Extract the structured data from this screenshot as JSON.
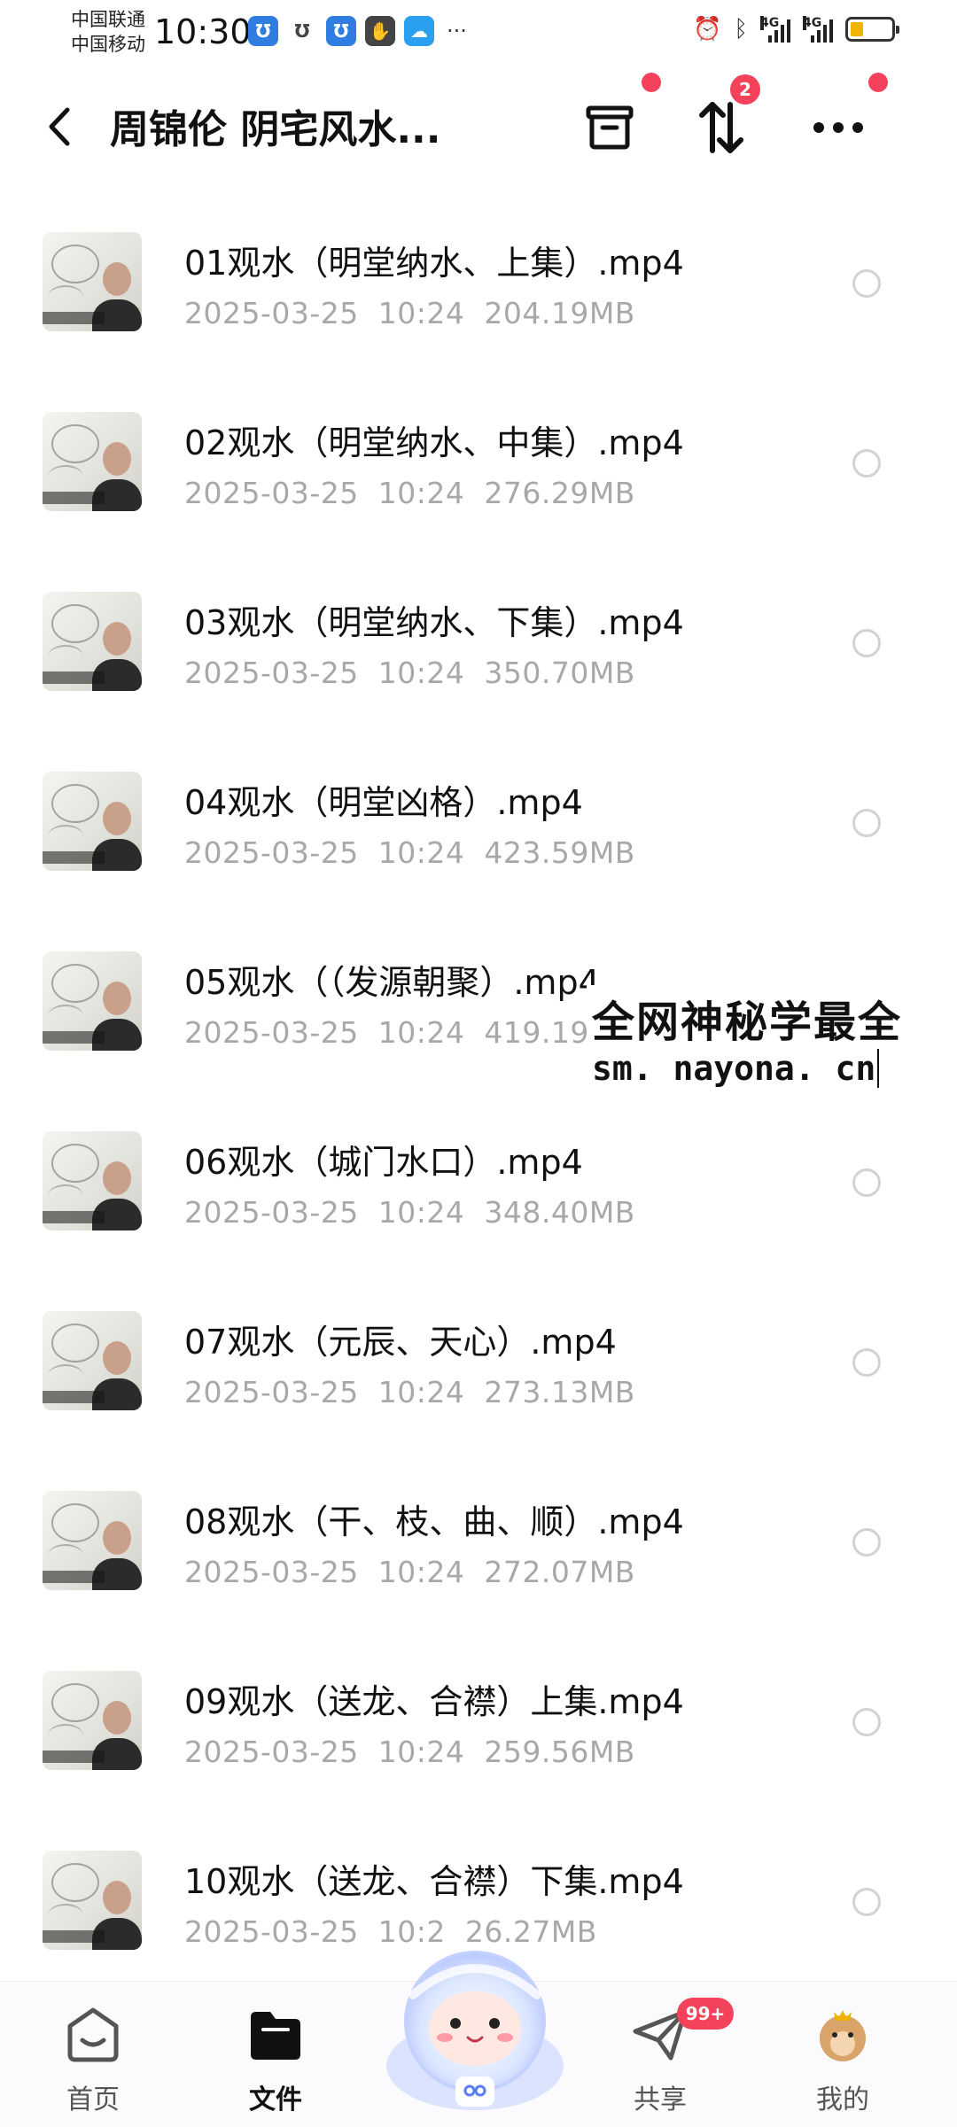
{
  "status_bar": {
    "carrier1": "中国联通",
    "carrier2": "中国移动",
    "time": "10:30",
    "network1": "4G",
    "network2": "4G"
  },
  "header": {
    "title": "周锦伦 阴宅风水...",
    "transfer_badge": "2"
  },
  "files": [
    {
      "name": "01观水（明堂纳水、上集）.mp4",
      "date": "2025-03-25",
      "time": "10:24",
      "size": "204.19MB"
    },
    {
      "name": "02观水（明堂纳水、中集）.mp4",
      "date": "2025-03-25",
      "time": "10:24",
      "size": "276.29MB"
    },
    {
      "name": "03观水（明堂纳水、下集）.mp4",
      "date": "2025-03-25",
      "time": "10:24",
      "size": "350.70MB"
    },
    {
      "name": "04观水（明堂凶格）.mp4",
      "date": "2025-03-25",
      "time": "10:24",
      "size": "423.59MB"
    },
    {
      "name": "05观水（（发源朝聚）.mp4",
      "date": "2025-03-25",
      "time": "10:24",
      "size": "419.19M"
    },
    {
      "name": "06观水（城门水口）.mp4",
      "date": "2025-03-25",
      "time": "10:24",
      "size": "348.40MB"
    },
    {
      "name": "07观水（元辰、天心）.mp4",
      "date": "2025-03-25",
      "time": "10:24",
      "size": "273.13MB"
    },
    {
      "name": "08观水（干、枝、曲、顺）.mp4",
      "date": "2025-03-25",
      "time": "10:24",
      "size": "272.07MB"
    },
    {
      "name": "09观水（送龙、合襟）上集.mp4",
      "date": "2025-03-25",
      "time": "10:24",
      "size": "259.56MB"
    },
    {
      "name": "10观水（送龙、合襟）下集.mp4",
      "date": "2025-03-25",
      "time": "10:2",
      "size": "26.27MB"
    }
  ],
  "watermark": {
    "line1": "全网神秘学最全",
    "line2": "sm. nayona. cn"
  },
  "bottom_nav": {
    "home": "首页",
    "files": "文件",
    "share": "共享",
    "share_badge": "99+",
    "mine": "我的"
  },
  "colors": {
    "accent_red": "#f4425a",
    "meta_gray": "#a8a8a8"
  }
}
